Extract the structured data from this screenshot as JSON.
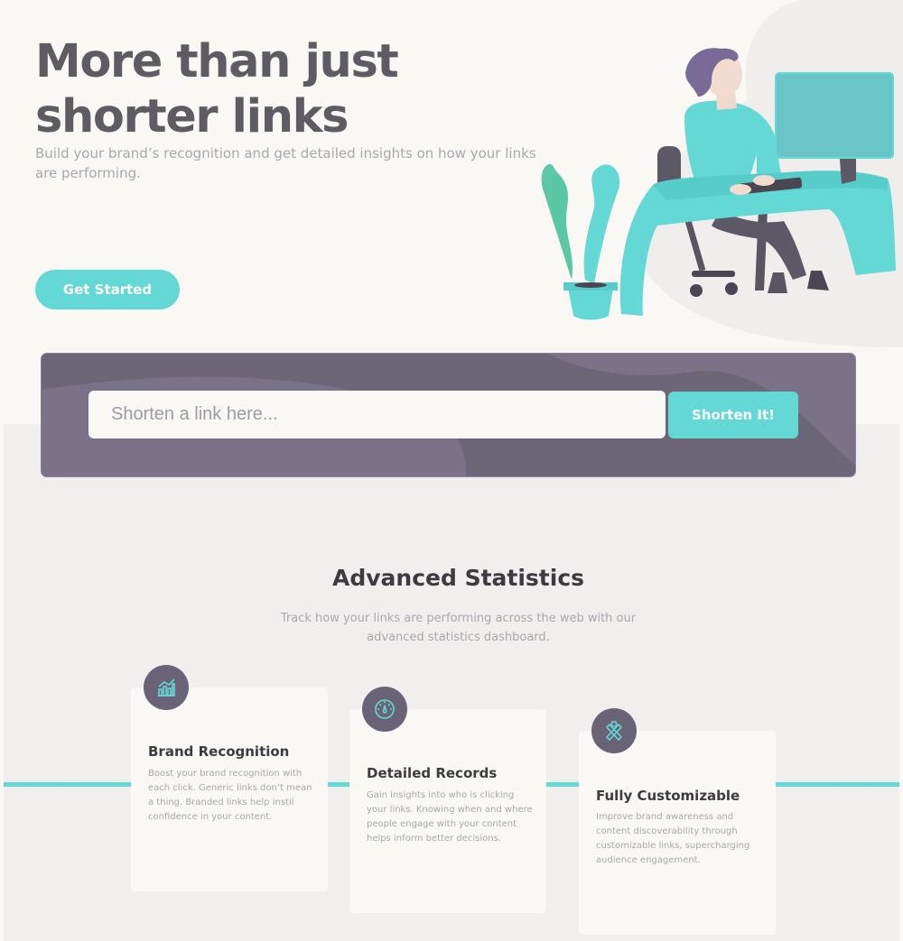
{
  "hero": {
    "title": "More than just shorter links",
    "subtitle": "Build your brand’s recognition and get detailed insights on how your links are performing.",
    "cta_label": "Get Started"
  },
  "shorten": {
    "placeholder": "Shorten a link here...",
    "button_label": "Shorten It!"
  },
  "statistics": {
    "title": "Advanced Statistics",
    "subtitle": "Track how your links are performing across the web with our advanced statistics dashboard.",
    "cards": [
      {
        "icon": "brand-recognition-chart-icon",
        "title": "Brand Recognition",
        "text": "Boost your brand recognition with each click. Generic links don’t mean a thing. Branded links help instil confidence in your content."
      },
      {
        "icon": "detailed-records-gauge-icon",
        "title": "Detailed Records",
        "text": "Gain insights into who is clicking your links. Knowing when and where people engage with your content helps inform better decisions."
      },
      {
        "icon": "fully-customizable-tools-icon",
        "title": "Fully Customizable",
        "text": "Improve brand awareness and content discoverability through customizable links, supercharging audience engagement."
      }
    ]
  },
  "colors": {
    "accent": "#63d8d5",
    "dark_violet": "#6d6578",
    "heading_gray": "#5e5c62",
    "body_gray": "#a9a7ae"
  }
}
